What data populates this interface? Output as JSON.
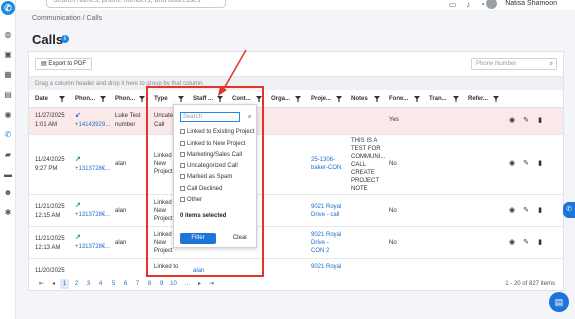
{
  "header": {
    "search_placeholder": "Search names, phone numbers, and addresses",
    "user_name": "Natisa Shamoon"
  },
  "breadcrumb": "Communication / Calls",
  "page_title": "Calls",
  "toolbar": {
    "export_label": "Export to PDF",
    "phone_search_placeholder": "Phone Number",
    "group_panel_hint": "Drag a column header and drop it here to group by that column."
  },
  "columns": [
    "Date",
    "Phon...",
    "Phon...",
    "Type",
    "Staff ...",
    "Cont...",
    "Orga...",
    "Proje...",
    "Notes",
    "Forw...",
    "Tran...",
    "Refer..."
  ],
  "rows": [
    {
      "date": "11/27/2025",
      "time": "1:01 AM",
      "phone1": "+14143929...",
      "phone2a": "Luke Test",
      "phone2b": "number",
      "type_a": "Uncatego",
      "type_b": "Call",
      "project_a": "",
      "project_b": "",
      "notes": [],
      "forwarded": "Yes",
      "direction": "in"
    },
    {
      "date": "11/24/2025",
      "time": "9:27 PM",
      "phone1": "+1313728€...",
      "phone2a": "alan",
      "phone2b": "",
      "type_a": "Linked to",
      "type_b": "New",
      "type_c": "Project",
      "project_a": "25-1306-",
      "project_b": "baker-CON",
      "notes": [
        "THIS IS A",
        "TEST FOR",
        "COMMUNI...",
        "CALL",
        "CREATE",
        "PROJECT",
        "NOTE"
      ],
      "forwarded": "No",
      "direction": "out"
    },
    {
      "date": "11/21/2025",
      "time": "12:15 AM",
      "phone1": "+1313728€...",
      "phone2a": "alan",
      "phone2b": "",
      "type_a": "Linked to",
      "type_b": "New",
      "type_c": "Project",
      "project_a": "9021 Royal",
      "project_b": "Drive - call",
      "notes": [],
      "forwarded": "No",
      "direction": "out"
    },
    {
      "date": "11/21/2025",
      "time": "12:13 AM",
      "phone1": "+1313728€...",
      "phone2a": "alan",
      "phone2b": "",
      "type_a": "Linked to",
      "type_b": "New",
      "type_c": "Project",
      "project_a": "9021 Royal",
      "project_b": "Drive -",
      "project_c": "CON 2",
      "notes": [],
      "forwarded": "No",
      "direction": "out"
    },
    {
      "date": "11/20/2025",
      "time": "",
      "phone1": "",
      "phone2a": "",
      "phone2b": "",
      "type_a": "Linked to",
      "type_b": "",
      "contact": "alan",
      "project_a": "9021 Royal",
      "project_b": "",
      "notes": [],
      "forwarded": "",
      "direction": ""
    }
  ],
  "filter_popup": {
    "search_placeholder": "Search",
    "options": [
      "Linked to Existing Project",
      "Linked to New Project",
      "Marketing/Sales Call",
      "Uncategorized Call",
      "Marked as Spam",
      "Call Declined",
      "Other"
    ],
    "selected_count": "0 items selected",
    "filter_label": "Filter",
    "clear_label": "Clear"
  },
  "pagination": {
    "pages": [
      "1",
      "2",
      "3",
      "4",
      "5",
      "6",
      "7",
      "8",
      "9",
      "10",
      "..."
    ],
    "current": "1",
    "range_label": "1 - 20 of 827 items"
  },
  "colors": {
    "accent": "#1e74d8",
    "annotation": "#e5332a",
    "highlight_row": "#fbe9ea"
  }
}
